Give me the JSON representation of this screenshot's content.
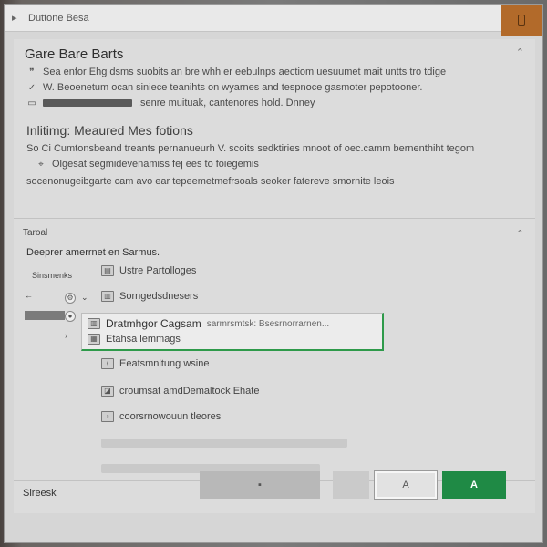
{
  "window": {
    "title": "Duttone Besa",
    "title_icon": "bookmark-icon"
  },
  "section1": {
    "heading": "Gare Bare Barts",
    "lines": [
      {
        "icon": "format-icon",
        "text": "Sea enfor Ehg dsms suobits an bre whh er eebulnps aectiom uesuumet mait untts tro tdige"
      },
      {
        "icon": "check-icon",
        "text": "W. Beoenetum ocan siniece teanihts on wyarnes and tespnoce gasmoter pepotooner."
      },
      {
        "icon": "tag-icon",
        "text": ".senre muituak, cantenores hold.    Dnney"
      }
    ]
  },
  "section2": {
    "heading": "Inlitimg: Meaured Mes fotions",
    "lines": [
      "So Ci Cumtonsbeand treants pernanueurh V. scoits sedktiries mnoot of oec.camm bernenthiht tegom",
      "Olgesat segmidevenamiss fej ees to foiegemis",
      "socenonugeibgarte cam avo ear  tepeemetmefrsoals seoker fatereve smornite leois"
    ]
  },
  "section3": {
    "label": "Taroal",
    "subheading": "Deeprer amerrnet en Sarmus.",
    "left_label": "Sinsmenks",
    "items": [
      {
        "icon": "folder-icon",
        "text": "Ustre Partolloges"
      },
      {
        "icon": "document-icon",
        "text": "Sorngedsdnesers"
      },
      {
        "icon": "link-icon",
        "text": "Eeatsmnltung wsine"
      },
      {
        "icon": "image-icon",
        "text": "croumsat amdDemaltock Ehate"
      },
      {
        "icon": "file-icon",
        "text": "coorsrnowouun tleores"
      }
    ],
    "selected": {
      "primary": "Dratmhgor Cagsam",
      "primary_detail": "sarmrsmtsk: Bsesrnorrarnen...",
      "secondary": "Etahsa lemmags"
    }
  },
  "footer": {
    "label": "Sireesk",
    "main_button": "",
    "outline_button": "A",
    "green_button": "A"
  }
}
